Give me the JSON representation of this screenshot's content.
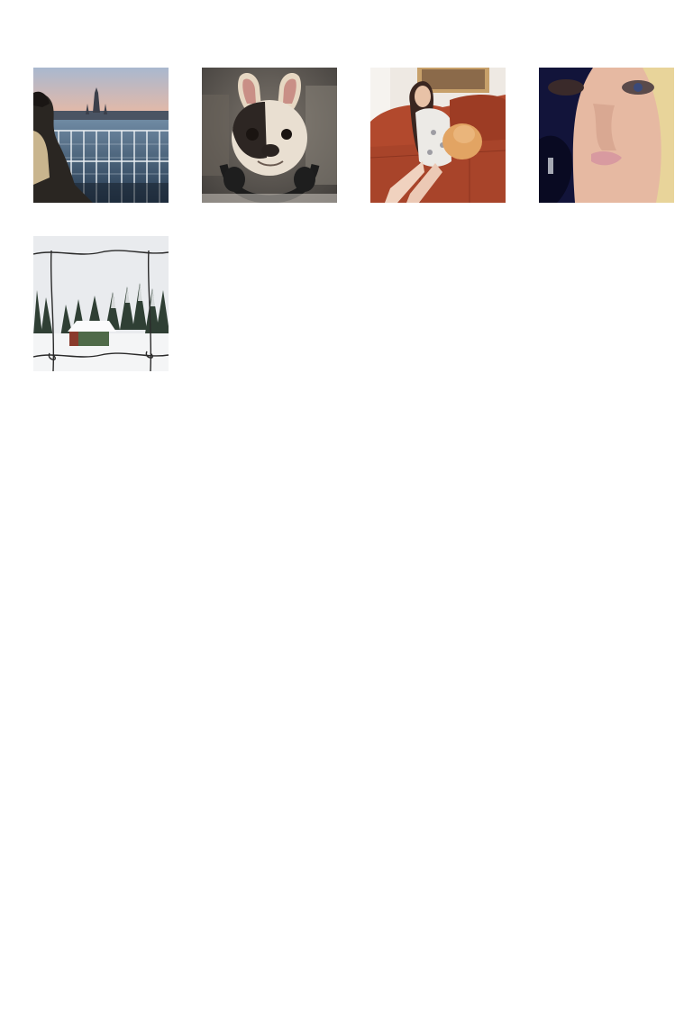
{
  "gallery": {
    "photos": [
      {
        "subject": "balcony-river-view",
        "palette": {
          "sky_top": "#a9b8cf",
          "sky_bottom": "#e9b9a4",
          "water": "#2e4a66",
          "railing": "#e8eef2"
        }
      },
      {
        "subject": "french-bulldog-with-headphones",
        "palette": {
          "bg": "#5b5752",
          "fur": "#e7dccd",
          "patch": "#2c2522",
          "headphones": "#1e1e1e"
        }
      },
      {
        "subject": "woman-with-pomeranian-on-sofa",
        "palette": {
          "wall": "#eee9e3",
          "sofa": "#a8442a",
          "dress": "#eceae6",
          "dog": "#e2a463"
        }
      },
      {
        "subject": "face-closeup",
        "palette": {
          "shadow": "#12143a",
          "skin": "#e6b9a2",
          "hair": "#e8d49a",
          "lips": "#d89aa0"
        }
      },
      {
        "subject": "snowy-cabin-behind-wire-fence",
        "palette": {
          "sky": "#e9ebee",
          "snow": "#f4f5f6",
          "trees": "#2f3f34",
          "cabin": "#4f6a48",
          "wire": "#2a2a2a"
        }
      }
    ]
  }
}
